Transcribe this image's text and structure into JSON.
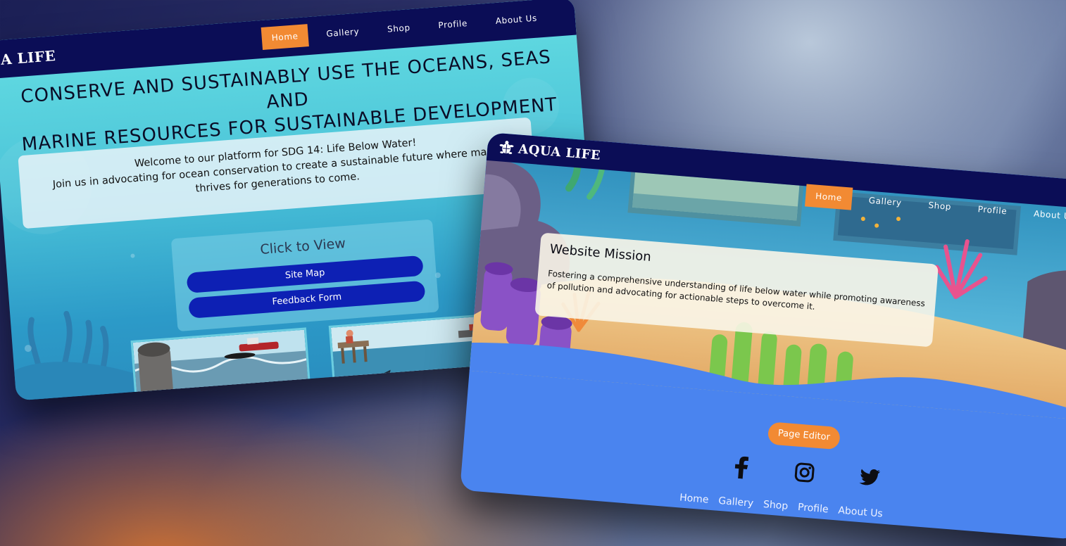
{
  "colors": {
    "nav_bg": "#0b0d56",
    "active_nav": "#f28a33",
    "primary_button": "#0d20b4",
    "footer_bg": "#4a84ef",
    "accent_orange": "#f28a33"
  },
  "back_window": {
    "logo_text": "A LIFE",
    "nav": [
      "Home",
      "Gallery",
      "Shop",
      "Profile",
      "About Us"
    ],
    "active_nav": "Home",
    "hero_title_line1": "CONSERVE AND SUSTAINABLY USE THE OCEANS, SEAS AND",
    "hero_title_line2": "MARINE RESOURCES FOR SUSTAINABLE DEVELOPMENT",
    "welcome_line1": "Welcome to our platform for SDG 14: Life Below Water!",
    "welcome_line2": "Join us in advocating for ocean conservation to create a sustainable future where marin",
    "welcome_line3": "thrives for generations to come.",
    "click_to_view": "Click to View",
    "site_map_button": "Site Map",
    "feedback_button": "Feedback Form"
  },
  "front_window": {
    "logo_text": "AQUA LIFE",
    "logo_icon": "turtle-icon",
    "nav": [
      "Home",
      "Gallery",
      "Shop",
      "Profile",
      "About U"
    ],
    "active_nav": "Home",
    "mission_title": "Website Mission",
    "mission_text": "Fostering a comprehensive understanding of life below water while promoting awareness of pollution and advocating for actionable steps to overcome it.",
    "page_editor_button": "Page Editor",
    "social_icons": [
      "facebook-icon",
      "instagram-icon",
      "twitter-icon"
    ],
    "footer_links": [
      "Home",
      "Gallery",
      "Shop",
      "Profile",
      "About Us"
    ]
  }
}
